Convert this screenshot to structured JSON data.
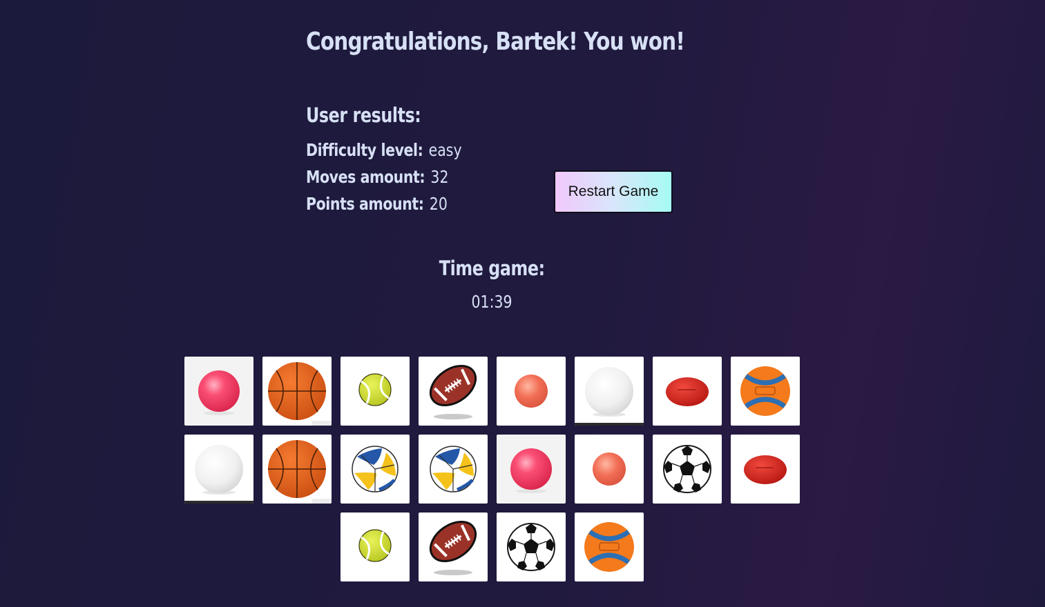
{
  "header": {
    "title": "Congratulations, Bartek! You won!"
  },
  "results": {
    "heading": "User results:",
    "difficulty_label": "Difficulty level:",
    "difficulty_value": "easy",
    "moves_label": "Moves amount:",
    "moves_value": "32",
    "points_label": "Points amount:",
    "points_value": "20"
  },
  "actions": {
    "restart_label": "Restart Game"
  },
  "time": {
    "heading": "Time game:",
    "value": "01:39"
  },
  "board": {
    "rows": [
      [
        "pink-ball",
        "basketball",
        "tennis-ball",
        "american-football",
        "coral-ball",
        "white-ball",
        "red-rugby-ball",
        "orange-dog-ball"
      ],
      [
        "white-ball",
        "basketball",
        "volleyball",
        "volleyball",
        "pink-ball",
        "coral-ball",
        "soccer-ball",
        "red-rugby-ball"
      ],
      [
        "tennis-ball",
        "american-football",
        "soccer-ball",
        "orange-dog-ball"
      ]
    ]
  },
  "colors": {
    "background": "#1d1b3d",
    "text": "#d7e0f5",
    "button_gradient_start": "#f1c8fb",
    "button_gradient_end": "#a6fbf4"
  }
}
